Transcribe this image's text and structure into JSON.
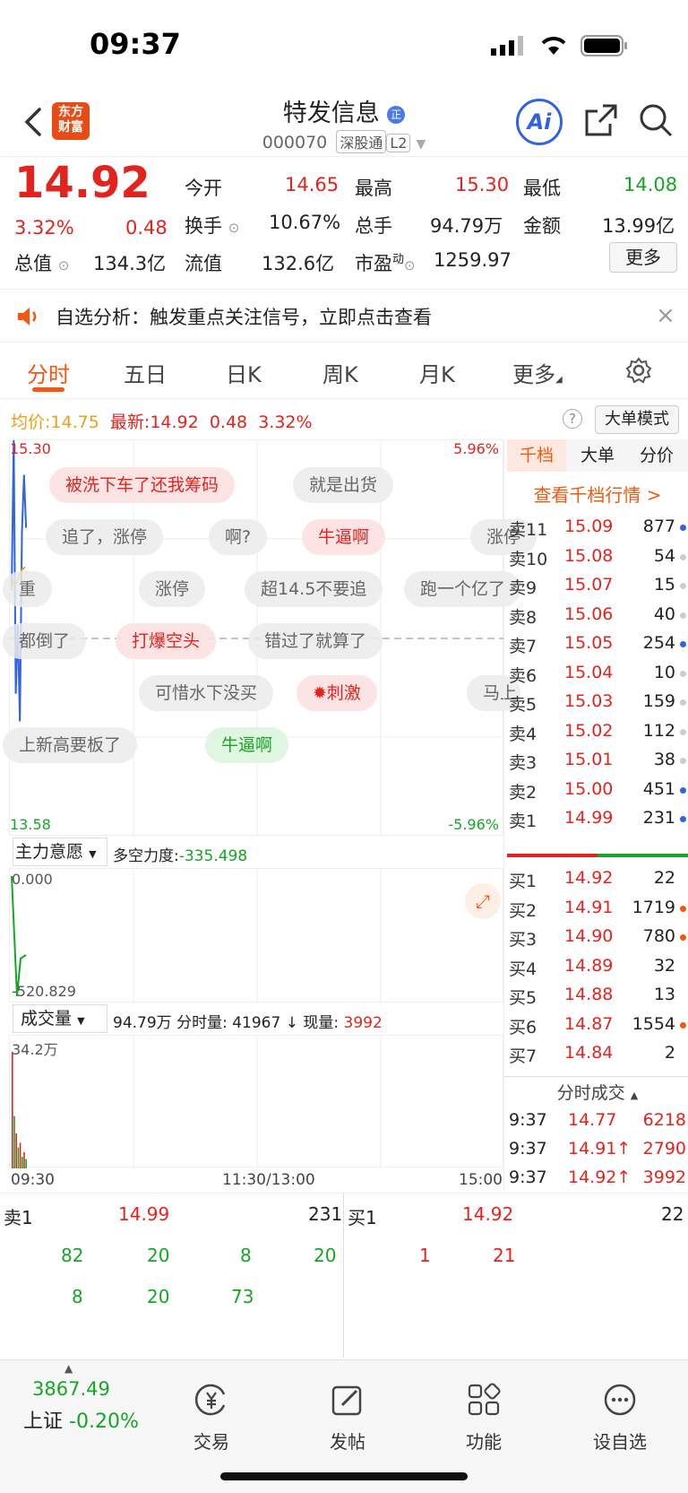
{
  "status": {
    "time": "09:37"
  },
  "header": {
    "logo": "东方\n财富",
    "title": "特发信息",
    "code": "000070",
    "tags": [
      "深股通",
      "L2"
    ],
    "ai_label": "Ai"
  },
  "quote": {
    "price": "14.92",
    "change_pct": "3.32%",
    "change": "0.48",
    "open_label": "今开",
    "open": "14.65",
    "high_label": "最高",
    "high": "15.30",
    "low_label": "最低",
    "low": "14.08",
    "turnover_label": "换手",
    "turnover": "10.67%",
    "volume_label": "总手",
    "volume": "94.79万",
    "amount_label": "金额",
    "amount": "13.99亿",
    "mcap_label": "总值",
    "mcap": "134.3亿",
    "float_label": "流值",
    "float": "132.6亿",
    "pe_label": "市盈",
    "pe_sup": "动",
    "pe": "1259.97",
    "more_label": "更多"
  },
  "notice": {
    "text": "自选分析：触发重点关注信号，立即点击查看"
  },
  "tabs": [
    "分时",
    "五日",
    "日K",
    "周K",
    "月K",
    "更多"
  ],
  "chart_header": {
    "avg_label": "均价:",
    "avg": "14.75",
    "latest_label": "最新:",
    "latest": "14.92",
    "chg": "0.48",
    "pct": "3.32%",
    "bigmode_label": "大单模式"
  },
  "chart_data": {
    "type": "line",
    "y_top": "15.30",
    "y_bottom": "13.58",
    "pct_top": "5.96%",
    "pct_bottom": "-5.96%",
    "x_ticks": [
      "09:30",
      "11:30/13:00",
      "15:00"
    ],
    "price": [
      14.65,
      15.3,
      14.2,
      14.5,
      14.08,
      14.9,
      15.15,
      14.92
    ],
    "avg": [
      14.65,
      14.7,
      14.68,
      14.72,
      14.74,
      14.75
    ]
  },
  "bubbles": [
    "被洗下车了还我筹码",
    "就是出货",
    "追了，涨停",
    "啊?",
    "牛逼啊",
    "涨停",
    "重",
    "涨停",
    "超14.5不要追",
    "跑一个亿了",
    "都倒了",
    "打爆空头",
    "错过了就算了",
    "可惜水下没买",
    "刺激",
    "马上",
    "上新高要板了",
    "牛逼啊",
    "涨停"
  ],
  "indicator": {
    "name": "主力意愿",
    "force_label": "多空力度:",
    "force": "-335.498",
    "top": "0.000",
    "bottom": "-520.829"
  },
  "volume_panel": {
    "name": "成交量",
    "total": "94.79万",
    "tick_label": "分时量:",
    "tick": "41967",
    "now_label": "现量:",
    "now": "3992",
    "max": "34.2万",
    "bars": [
      1.0,
      0.45,
      0.3,
      0.18,
      0.22,
      0.1,
      0.14,
      0.08
    ]
  },
  "orderbook": {
    "tabs": [
      "千档",
      "大单",
      "分价"
    ],
    "link": "查看千档行情 >",
    "asks": [
      {
        "label": "卖11",
        "price": "15.09",
        "vol": "877",
        "dot": "#2e63e6"
      },
      {
        "label": "卖10",
        "price": "15.08",
        "vol": "54",
        "dot": "#ccc"
      },
      {
        "label": "卖9",
        "price": "15.07",
        "vol": "15",
        "dot": "#ccc"
      },
      {
        "label": "卖8",
        "price": "15.06",
        "vol": "40",
        "dot": "#ccc"
      },
      {
        "label": "卖7",
        "price": "15.05",
        "vol": "254",
        "dot": "#2e63e6"
      },
      {
        "label": "卖6",
        "price": "15.04",
        "vol": "10",
        "dot": "#ccc"
      },
      {
        "label": "卖5",
        "price": "15.03",
        "vol": "159",
        "dot": "#ccc"
      },
      {
        "label": "卖4",
        "price": "15.02",
        "vol": "112",
        "dot": "#ccc"
      },
      {
        "label": "卖3",
        "price": "15.01",
        "vol": "38",
        "dot": "#ccc"
      },
      {
        "label": "卖2",
        "price": "15.00",
        "vol": "451",
        "dot": "#2e63e6"
      },
      {
        "label": "卖1",
        "price": "14.99",
        "vol": "231",
        "dot": "#2e63e6"
      }
    ],
    "bids": [
      {
        "label": "买1",
        "price": "14.92",
        "vol": "22",
        "dot": ""
      },
      {
        "label": "买2",
        "price": "14.91",
        "vol": "1719",
        "dot": "#ee5a12"
      },
      {
        "label": "买3",
        "price": "14.90",
        "vol": "780",
        "dot": "#ee5a12"
      },
      {
        "label": "买4",
        "price": "14.89",
        "vol": "32",
        "dot": ""
      },
      {
        "label": "买5",
        "price": "14.88",
        "vol": "13",
        "dot": ""
      },
      {
        "label": "买6",
        "price": "14.87",
        "vol": "1554",
        "dot": "#ee5a12"
      },
      {
        "label": "买7",
        "price": "14.84",
        "vol": "2",
        "dot": ""
      }
    ],
    "trades_title": "分时成交",
    "trades": [
      {
        "time": "9:37",
        "price": "14.77",
        "arrow": "",
        "vol": "6218"
      },
      {
        "time": "9:37",
        "price": "14.91",
        "arrow": "↑",
        "vol": "2790"
      },
      {
        "time": "9:37",
        "price": "14.92",
        "arrow": "↑",
        "vol": "3992"
      }
    ]
  },
  "strip": {
    "sell_label": "卖1",
    "sell_price": "14.99",
    "sell_vol": "231",
    "buy_label": "买1",
    "buy_price": "14.92",
    "buy_vol": "22",
    "sell_queue_row1": [
      "82",
      "20",
      "8",
      "20"
    ],
    "sell_queue_row2": [
      "8",
      "20",
      "73"
    ],
    "buy_queue": [
      "1",
      "21"
    ]
  },
  "tabbar": {
    "index_value": "3867.49",
    "index_name": "上证",
    "index_chg": "-0.20%",
    "items": [
      "交易",
      "发帖",
      "功能",
      "设自选"
    ]
  }
}
